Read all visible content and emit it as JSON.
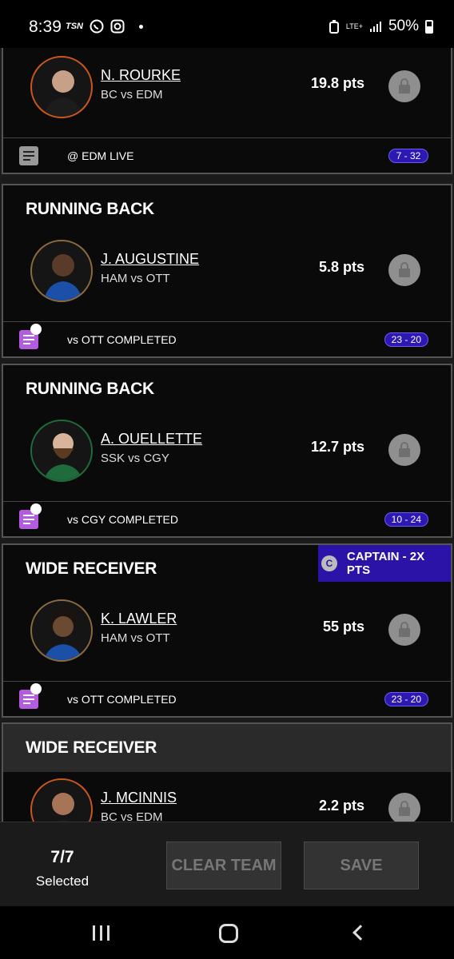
{
  "status_bar": {
    "time": "8:39",
    "tsn": "TSN",
    "network": "LTE+",
    "battery": "50%"
  },
  "cards": [
    {
      "position": "",
      "player": "N. ROURKE",
      "matchup": "BC vs EDM",
      "points": "19.8 pts",
      "status": "@ EDM LIVE",
      "score": "7 - 32",
      "note_icon": "note-grey-icon"
    },
    {
      "position": "RUNNING BACK",
      "player": "J. AUGUSTINE",
      "matchup": "HAM vs OTT",
      "points": "5.8 pts",
      "status": "vs OTT COMPLETED",
      "score": "23 - 20",
      "note_icon": "note-purple-icon"
    },
    {
      "position": "RUNNING BACK",
      "player": "A. OUELLETTE",
      "matchup": "SSK vs CGY",
      "points": "12.7 pts",
      "status": "vs CGY COMPLETED",
      "score": "10 - 24",
      "note_icon": "note-purple-icon"
    },
    {
      "position": "WIDE RECEIVER",
      "player": "K. LAWLER",
      "matchup": "HAM vs OTT",
      "points": "55 pts",
      "status": "vs OTT COMPLETED",
      "score": "23 - 20",
      "captain_badge": "CAPTAIN - 2X PTS",
      "captain_letter": "C",
      "note_icon": "note-purple-icon"
    },
    {
      "position": "WIDE RECEIVER",
      "player": "J. MCINNIS",
      "matchup": "BC vs EDM",
      "points": "2.2 pts"
    }
  ],
  "footer": {
    "selected_count": "7/7",
    "selected_label": "Selected",
    "clear_label": "CLEAR TEAM",
    "save_label": "SAVE"
  },
  "colors": {
    "accent": "#2c13a7",
    "note_purple": "#b35ce0",
    "score_badge": "#2c18b3"
  }
}
